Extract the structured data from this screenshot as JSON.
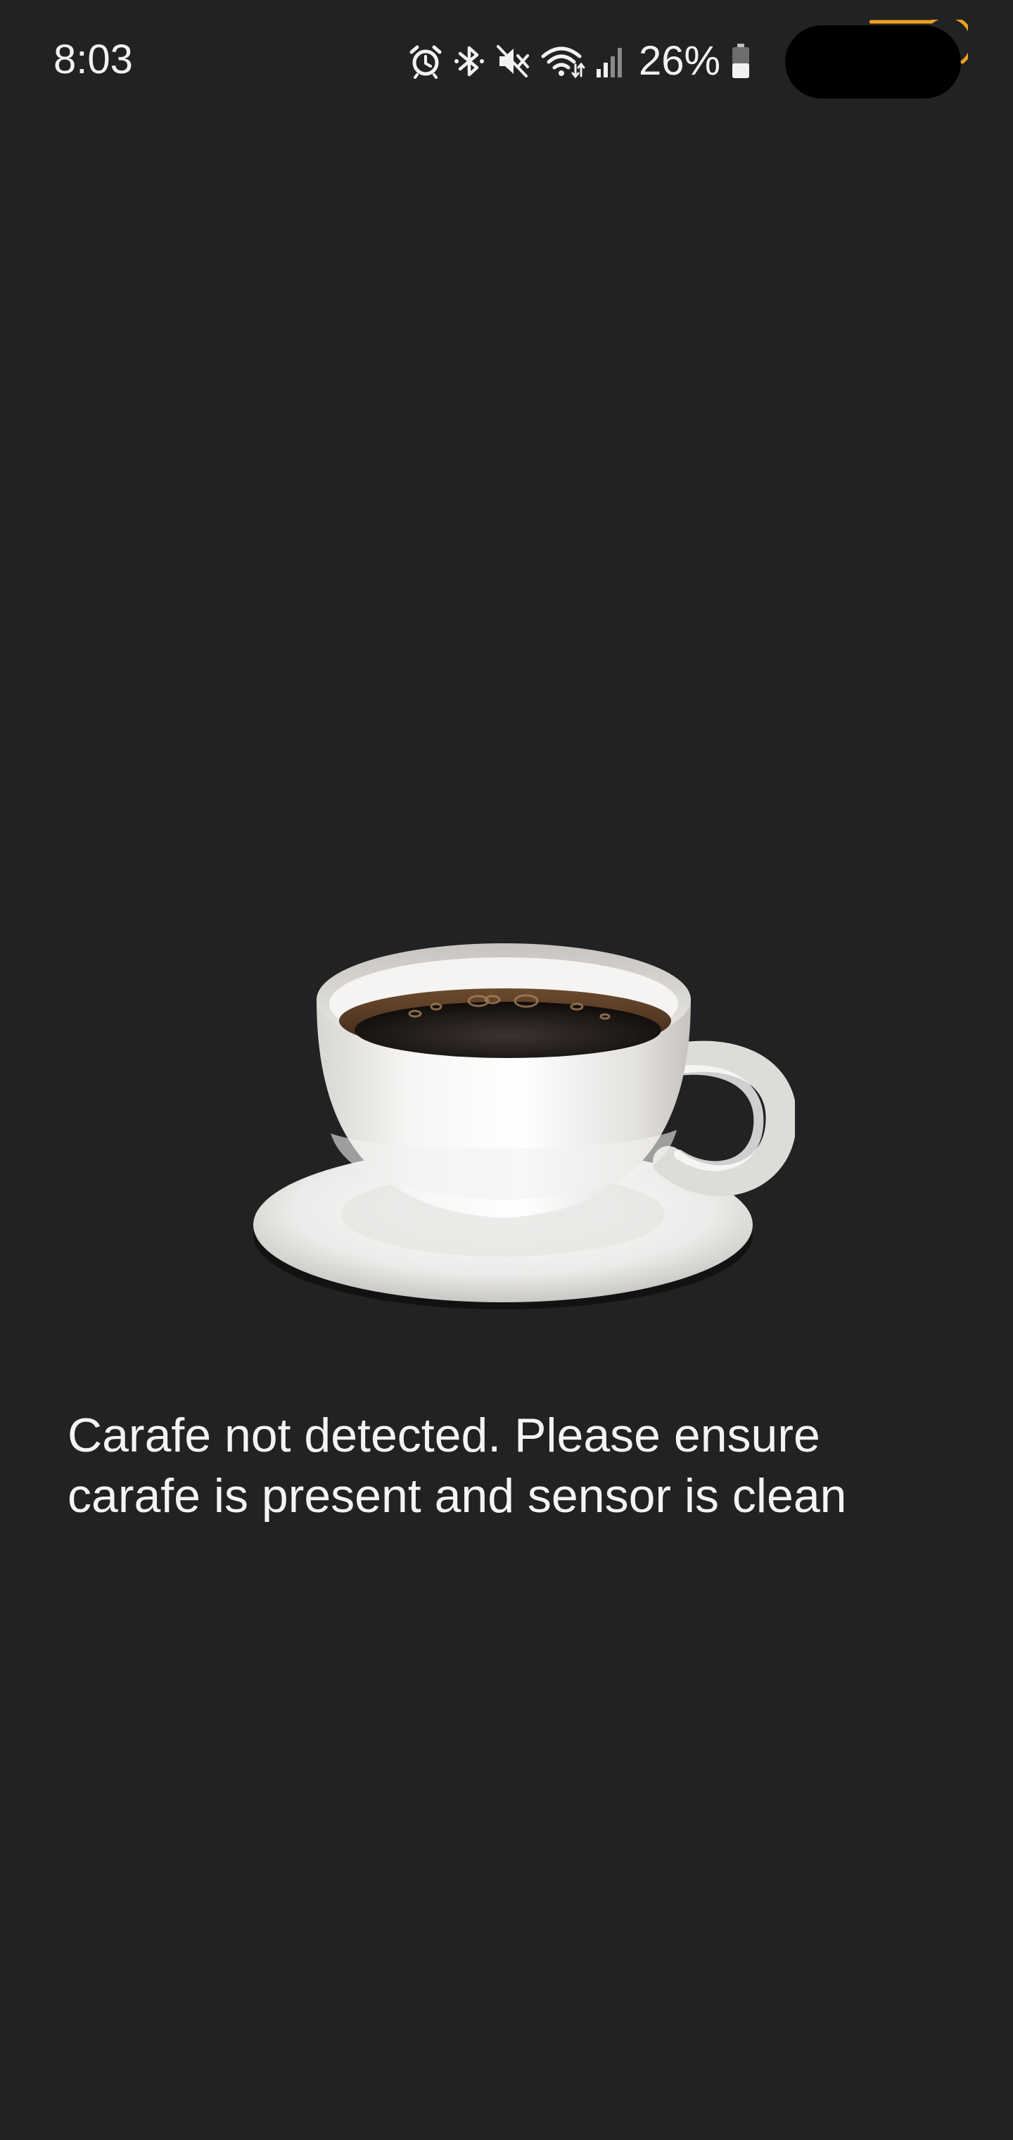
{
  "status_bar": {
    "time": "8:03",
    "battery_percent": "26%",
    "icons": [
      "alarm-icon",
      "bluetooth-icon",
      "mute-icon",
      "wifi-icon",
      "signal-icon",
      "battery-icon"
    ]
  },
  "main": {
    "illustration": "coffee-cup-icon",
    "message": "Carafe not detected. Please ensure carafe is present and sensor is clean"
  },
  "colors": {
    "background": "#212224",
    "text": "#f4f4f4",
    "accent": "#f0a020"
  }
}
